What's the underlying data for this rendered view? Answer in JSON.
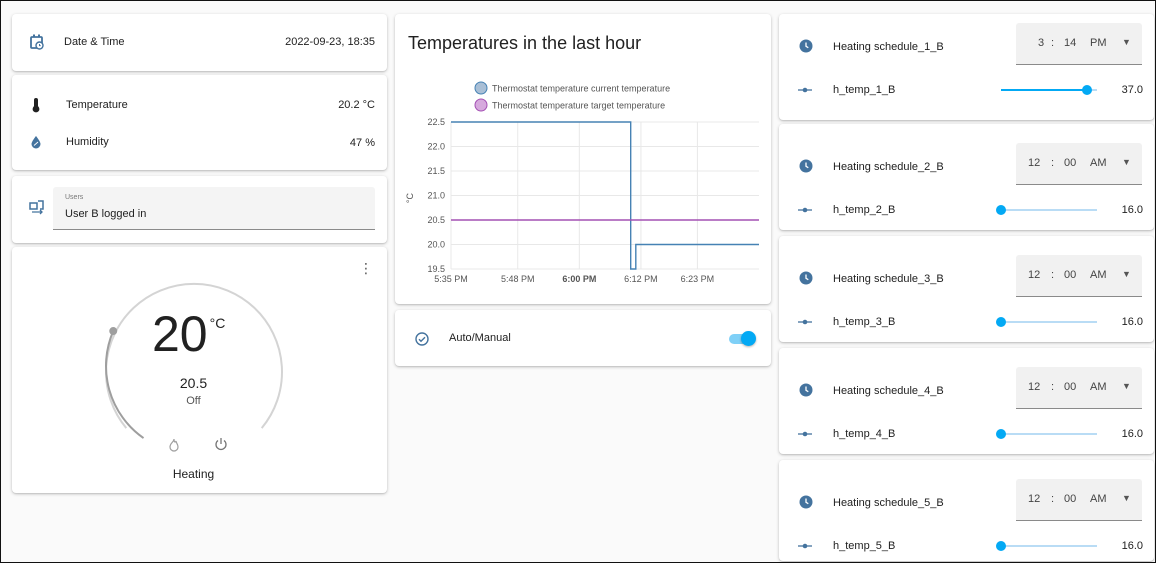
{
  "left": {
    "datetime": {
      "label": "Date & Time",
      "value": "2022-09-23, 18:35"
    },
    "temperature": {
      "label": "Temperature",
      "value": "20.2 °C"
    },
    "humidity": {
      "label": "Humidity",
      "value": "47 %"
    },
    "users": {
      "small_label": "Users",
      "value": "User B logged in"
    },
    "thermostat": {
      "target": "20",
      "unit": "°C",
      "current": "20.5",
      "state": "Off",
      "mode_label": "Heating",
      "level_fraction": 0.28
    }
  },
  "middle": {
    "chart_title": "Temperatures in the last hour",
    "auto_manual": {
      "label": "Auto/Manual",
      "on": true
    }
  },
  "chart_data": {
    "type": "line",
    "title": "Temperatures in the last hour",
    "ylabel": "°C",
    "ylim": [
      19.5,
      22.5
    ],
    "yticks": [
      "22.5",
      "22.0",
      "21.5",
      "21.0",
      "20.5",
      "20.0",
      "19.5"
    ],
    "xticks": [
      "5:35 PM",
      "5:48 PM",
      "6:00 PM",
      "6:12 PM",
      "6:23 PM"
    ],
    "xrange": [
      "5:35 PM",
      "6:35 PM"
    ],
    "series": [
      {
        "name": "Thermostat temperature current temperature",
        "color": "#4682b4",
        "points": [
          [
            "5:35 PM",
            22.5
          ],
          [
            "6:10 PM",
            22.5
          ],
          [
            "6:10 PM",
            19.5
          ],
          [
            "6:11 PM",
            19.5
          ],
          [
            "6:11 PM",
            20.0
          ],
          [
            "6:35 PM",
            20.0
          ]
        ]
      },
      {
        "name": "Thermostat temperature target temperature",
        "color": "#a450b4",
        "points": [
          [
            "5:35 PM",
            20.5
          ],
          [
            "6:35 PM",
            20.5
          ]
        ]
      }
    ],
    "legend": "top"
  },
  "right": {
    "schedules": [
      {
        "label": "Heating schedule_1_B",
        "hour": "3",
        "minute": "14",
        "ampm": "PM",
        "temp_label": "h_temp_1_B",
        "temp_value": "37.0",
        "level": 0.9
      },
      {
        "label": "Heating schedule_2_B",
        "hour": "12",
        "minute": "00",
        "ampm": "AM",
        "temp_label": "h_temp_2_B",
        "temp_value": "16.0",
        "level": 0.0
      },
      {
        "label": "Heating schedule_3_B",
        "hour": "12",
        "minute": "00",
        "ampm": "AM",
        "temp_label": "h_temp_3_B",
        "temp_value": "16.0",
        "level": 0.0
      },
      {
        "label": "Heating schedule_4_B",
        "hour": "12",
        "minute": "00",
        "ampm": "AM",
        "temp_label": "h_temp_4_B",
        "temp_value": "16.0",
        "level": 0.0
      },
      {
        "label": "Heating schedule_5_B",
        "hour": "12",
        "minute": "00",
        "ampm": "AM",
        "temp_label": "h_temp_5_B",
        "temp_value": "16.0",
        "level": 0.0
      }
    ],
    "colors": {
      "accent": "#03a9f4",
      "clock": "#44739e"
    }
  }
}
